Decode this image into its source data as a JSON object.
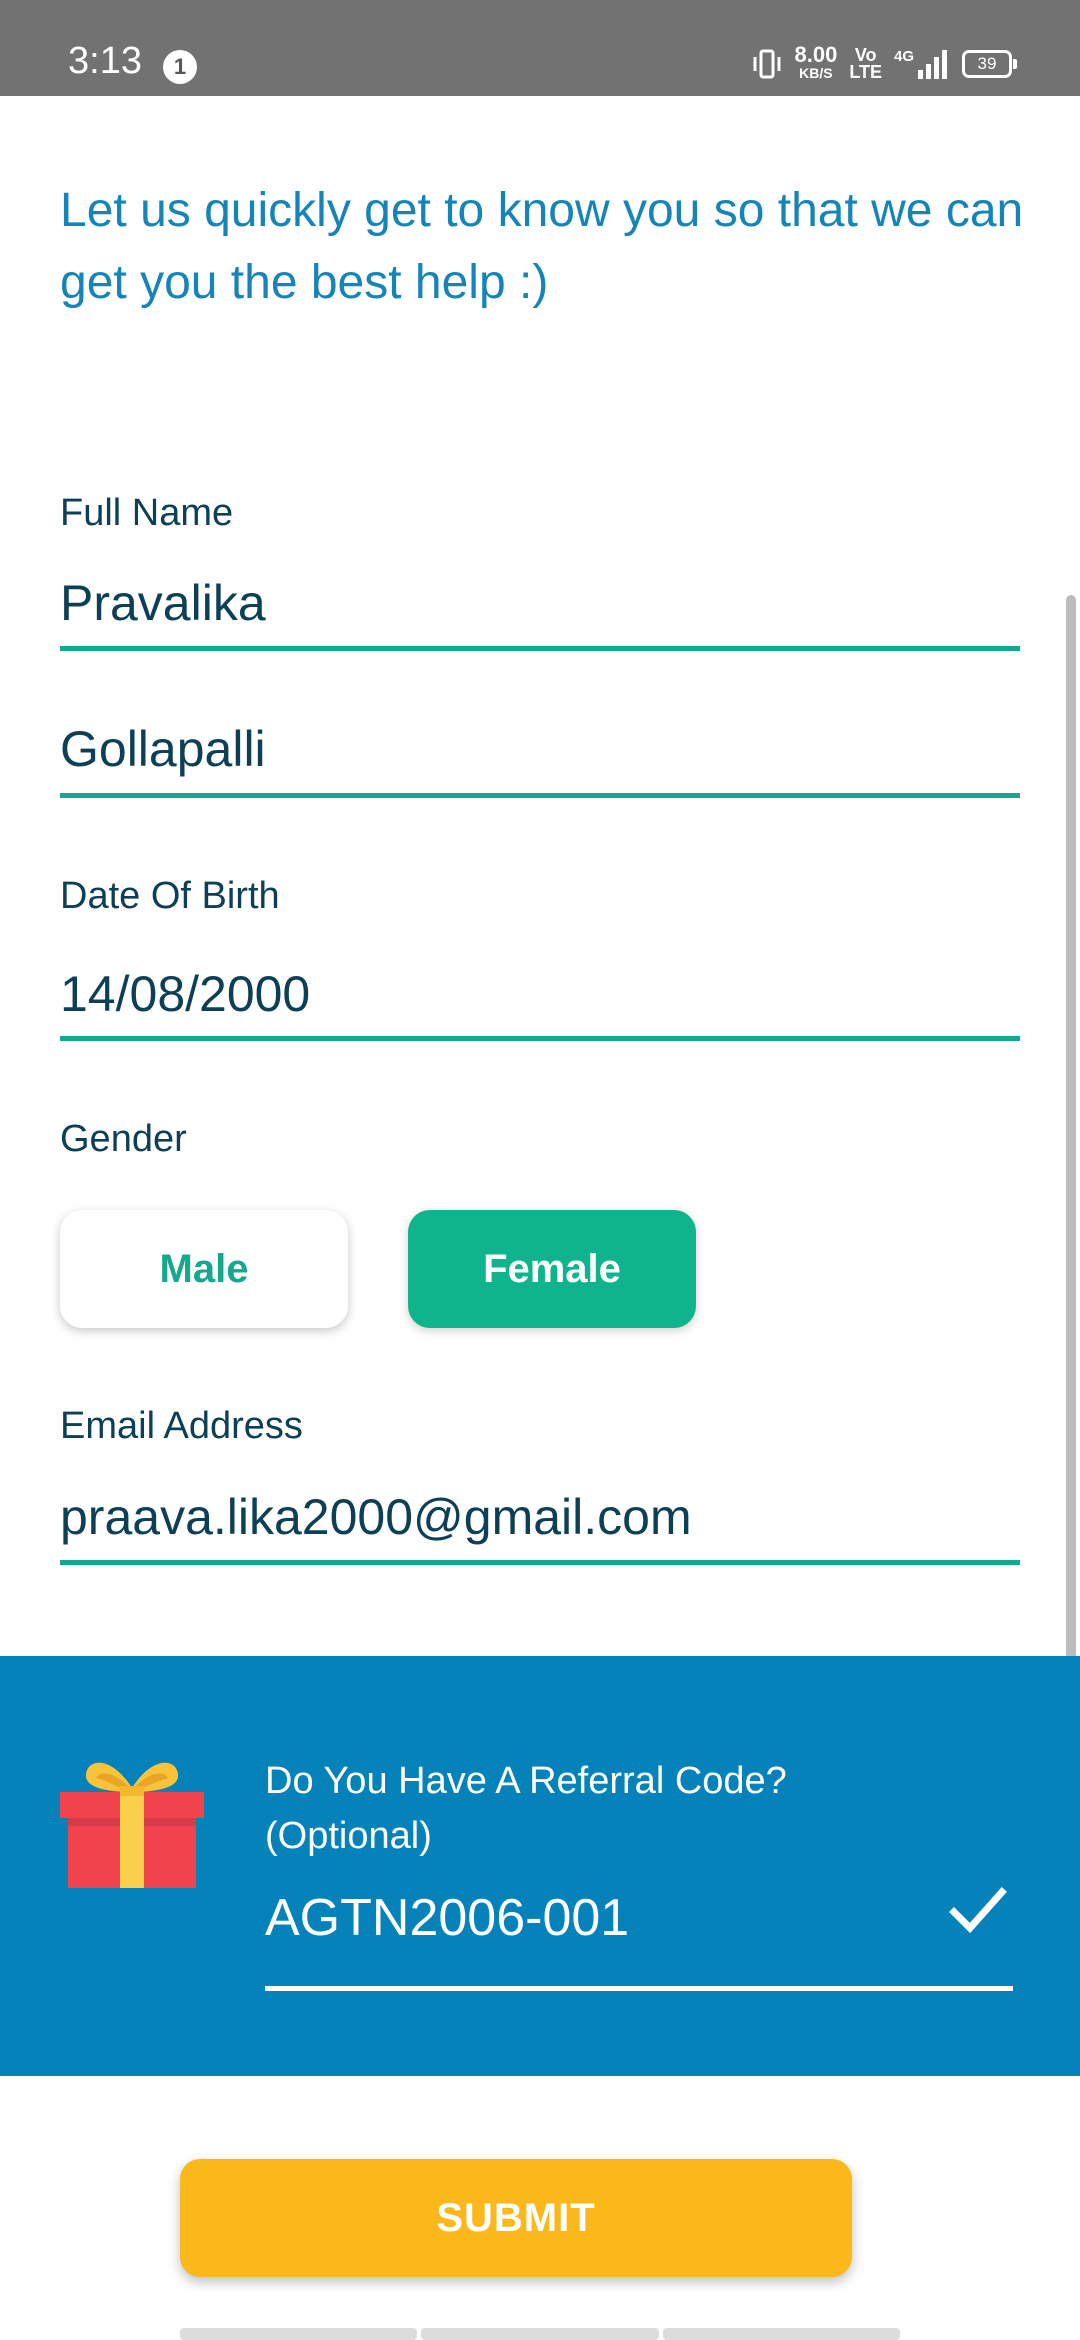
{
  "status_bar": {
    "time": "3:13",
    "notification_count": "1",
    "net_speed": "8.00",
    "net_speed_unit": "KB/S",
    "volte_top": "Vo",
    "volte_bottom": "LTE",
    "network": "4G",
    "battery": "39"
  },
  "intro_text": "Let us quickly get to know you so that we can get you the best help :)",
  "form": {
    "full_name_label": "Full Name",
    "first_name": "Pravalika",
    "last_name": "Gollapalli",
    "dob_label": "Date Of Birth",
    "dob": "14/08/2000",
    "gender_label": "Gender",
    "gender_options": [
      "Male",
      "Female"
    ],
    "gender_selected": "Female",
    "email_label": "Email Address",
    "email": "praava.lika2000@gmail.com"
  },
  "referral": {
    "question_line1": "Do You Have A Referral Code?",
    "question_line2": "(Optional)",
    "code": "AGTN2006-001",
    "gift_icon": "gift-icon",
    "confirm_icon": "check-icon"
  },
  "submit_label": "SUBMIT",
  "colors": {
    "accent_green": "#0fb48c",
    "referral_blue": "#0582b9",
    "submit_yellow": "#fbb81b",
    "intro_blue": "#1584b8",
    "text_dark": "#0d3f56"
  }
}
